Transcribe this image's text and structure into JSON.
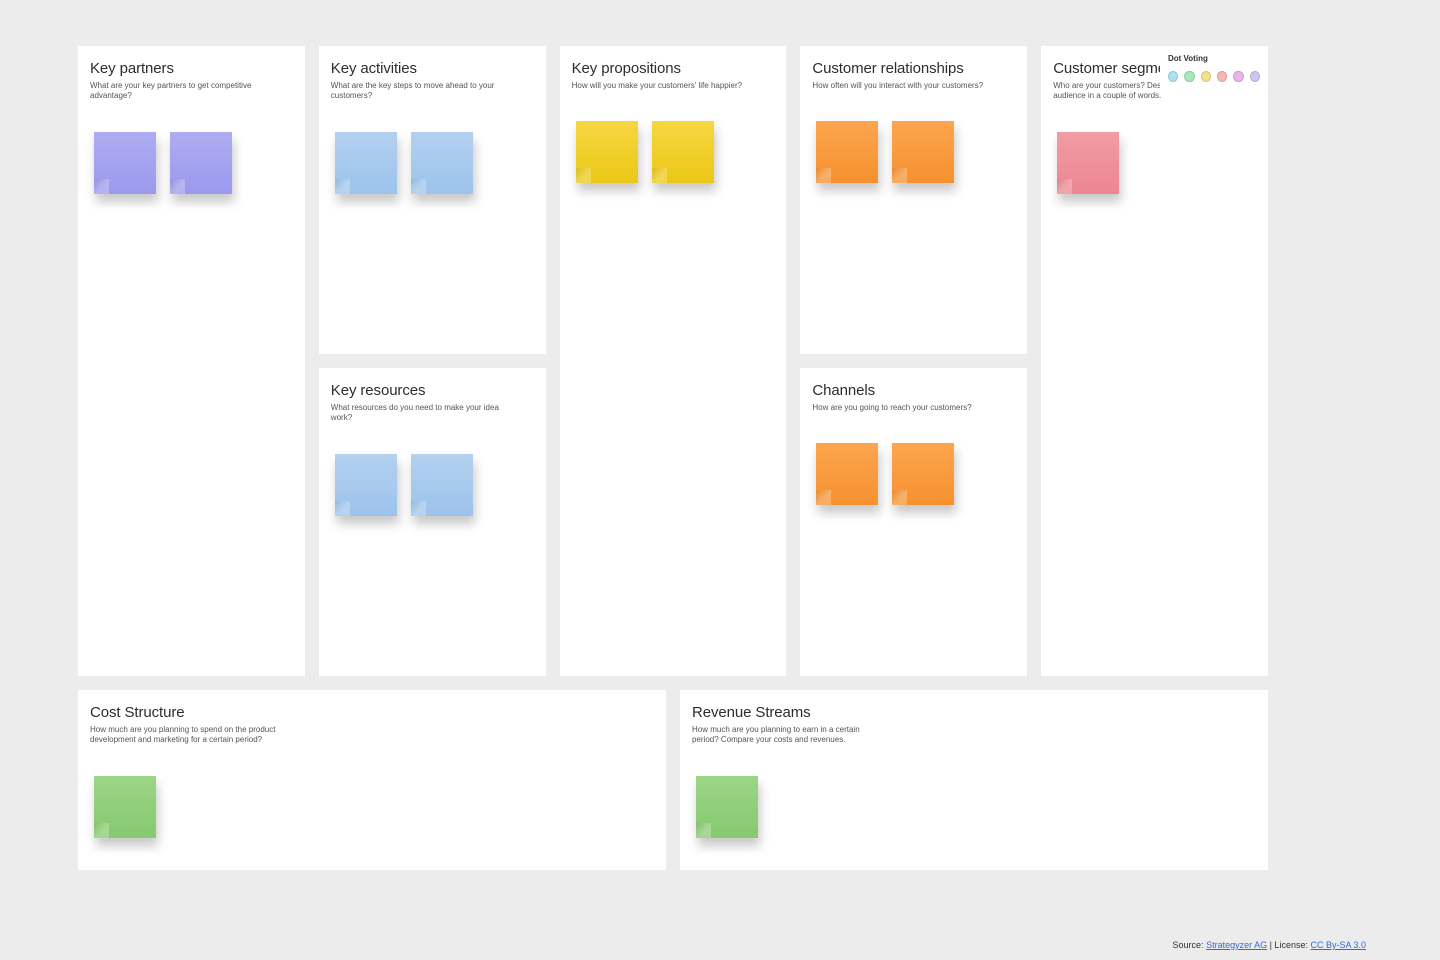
{
  "dotVoting": {
    "label": "Dot Voting"
  },
  "sections": {
    "keyPartners": {
      "title": "Key partners",
      "sub": "What are your key partners to get competitive advantage?"
    },
    "keyActivities": {
      "title": "Key activities",
      "sub": "What are the key steps to move ahead to your customers?"
    },
    "keyResources": {
      "title": "Key resources",
      "sub": "What resources do you need to make your idea work?"
    },
    "keyPropositions": {
      "title": "Key propositions",
      "sub": "How will you make your customers' life happier?"
    },
    "customerRelationships": {
      "title": "Customer relationships",
      "sub": "How often will you interact with your customers?"
    },
    "channels": {
      "title": "Channels",
      "sub": "How are you going to reach your customers?"
    },
    "customerSegments": {
      "title": "Customer segments",
      "sub": "Who are your customers? Describe your target audience in a couple of words."
    },
    "costStructure": {
      "title": "Cost Structure",
      "sub": "How much are you planning to spend on the product development and marketing for a certain period?"
    },
    "revenueStreams": {
      "title": "Revenue Streams",
      "sub": "How much are you planning to earn in a certain period? Compare your costs and revenues."
    }
  },
  "attribution": {
    "sourceLabel": "Source: ",
    "sourceName": "Strategyzer AG",
    "separator": " | License: ",
    "licenseName": "CC By-SA 3.0"
  }
}
